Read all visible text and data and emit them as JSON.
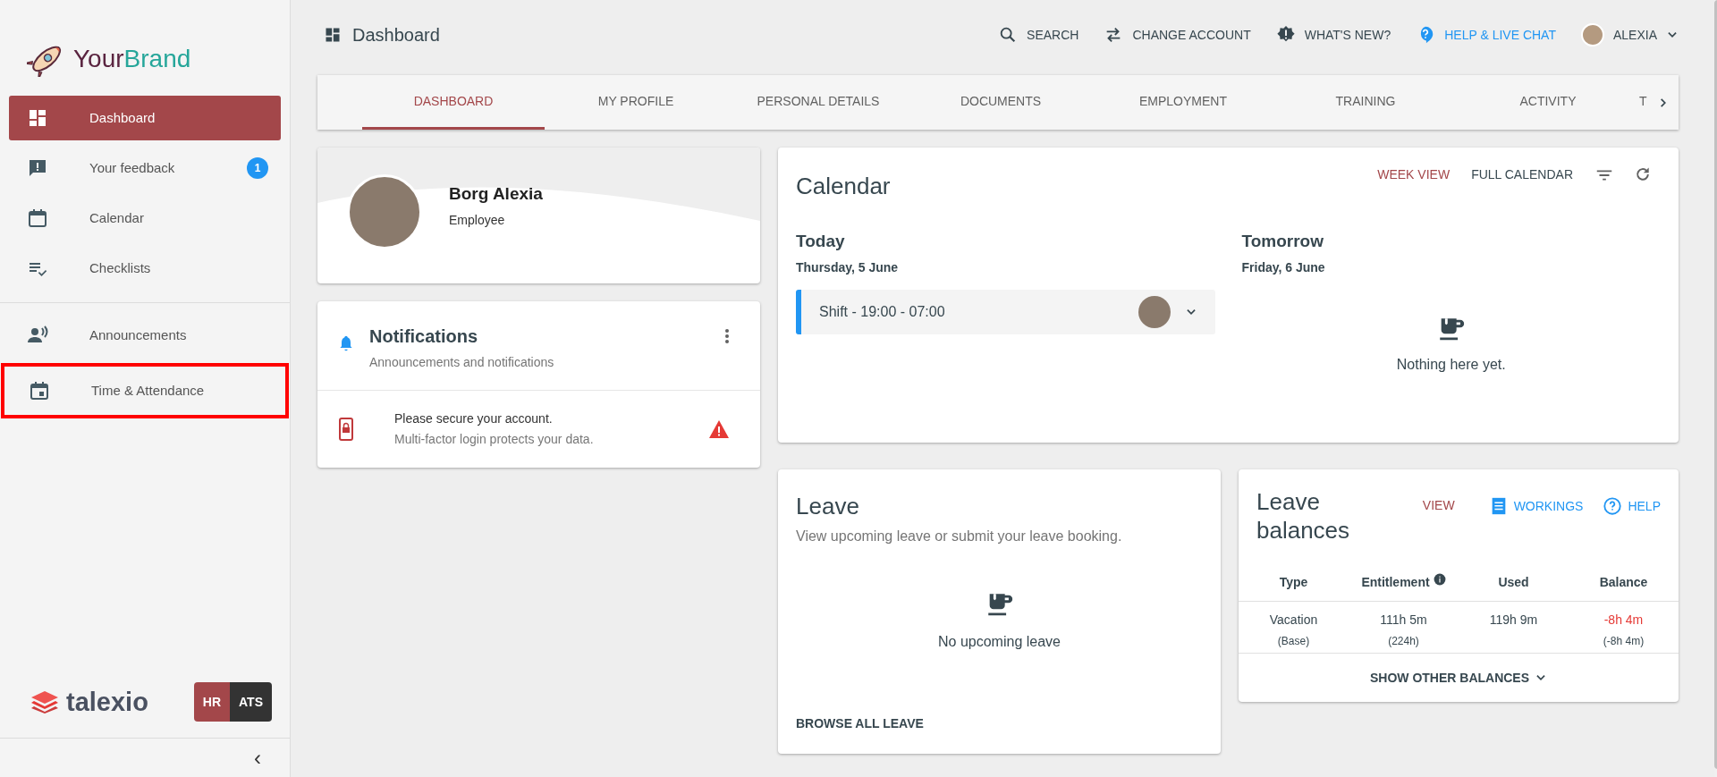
{
  "sidebar": {
    "brand": {
      "first": "Your",
      "second": "Brand"
    },
    "groups": [
      [
        {
          "label": "Dashboard",
          "selected": true,
          "highlighted": false
        },
        {
          "label": "Your feedback",
          "selected": false,
          "highlighted": false,
          "badge": "1"
        },
        {
          "label": "Calendar",
          "selected": false,
          "highlighted": false
        },
        {
          "label": "Checklists",
          "selected": false,
          "highlighted": false
        }
      ],
      [
        {
          "label": "Announcements",
          "selected": false,
          "highlighted": false
        },
        {
          "label": "Time & Attendance",
          "selected": false,
          "highlighted": true
        }
      ]
    ],
    "footer_logo": "talexio",
    "switch": [
      {
        "label": "HR",
        "selected": true
      },
      {
        "label": "ATS",
        "selected": false
      }
    ],
    "collapse": "‹"
  },
  "header": {
    "title": "Dashboard",
    "actions": [
      {
        "kind": "search",
        "label": "SEARCH"
      },
      {
        "kind": "switch",
        "label": "CHANGE ACCOUNT"
      },
      {
        "kind": "news",
        "label": "WHAT'S NEW?"
      },
      {
        "kind": "help",
        "label": "HELP & LIVE CHAT"
      },
      {
        "kind": "user",
        "label": "ALEXIA"
      }
    ]
  },
  "tabs": [
    {
      "label": "DASHBOARD",
      "selected": true
    },
    {
      "label": "MY PROFILE",
      "selected": false
    },
    {
      "label": "PERSONAL DETAILS",
      "selected": false
    },
    {
      "label": "DOCUMENTS",
      "selected": false
    },
    {
      "label": "EMPLOYMENT",
      "selected": false
    },
    {
      "label": "TRAINING",
      "selected": false
    },
    {
      "label": "ACTIVITY",
      "selected": false
    },
    {
      "label": "T",
      "selected": false
    }
  ],
  "profile": {
    "name": "Borg Alexia",
    "role": "Employee"
  },
  "notifications": {
    "title": "Notifications",
    "subtitle": "Announcements and notifications",
    "items": [
      {
        "title": "Please secure your account.",
        "text": "Multi-factor login protects your data."
      }
    ]
  },
  "calendar": {
    "title": "Calendar",
    "actions": [
      {
        "label": "WEEK VIEW",
        "selected": true
      },
      {
        "label": "FULL CALENDAR",
        "selected": false
      }
    ],
    "days": [
      {
        "heading": "Today",
        "date": "Thursday, 5 June",
        "events": [
          {
            "label": "Shift - 19:00 - 07:00",
            "color": "#2196f3"
          }
        ]
      },
      {
        "heading": "Tomorrow",
        "date": "Friday, 6 June",
        "empty": "Nothing here yet."
      }
    ]
  },
  "leave": {
    "title": "Leave",
    "subtitle": "View upcoming leave or submit your leave booking.",
    "empty": "No upcoming leave",
    "link": "BROWSE ALL LEAVE"
  },
  "balances": {
    "title": "Leave balances",
    "actions": [
      {
        "kind": "view",
        "label": "VIEW"
      },
      {
        "kind": "workings",
        "label": "WORKINGS"
      },
      {
        "kind": "help",
        "label": "HELP"
      }
    ],
    "columns": [
      "Type",
      "Entitlement",
      "Used",
      "Balance"
    ],
    "rows": [
      {
        "type": "Vacation",
        "type_note": "(Base)",
        "entitlement": "111h 5m",
        "entitlement_note": "(224h)",
        "used": "119h 9m",
        "balance": "-8h 4m",
        "balance_note": "(-8h 4m)",
        "negative": true
      }
    ],
    "more": "SHOW OTHER BALANCES"
  }
}
